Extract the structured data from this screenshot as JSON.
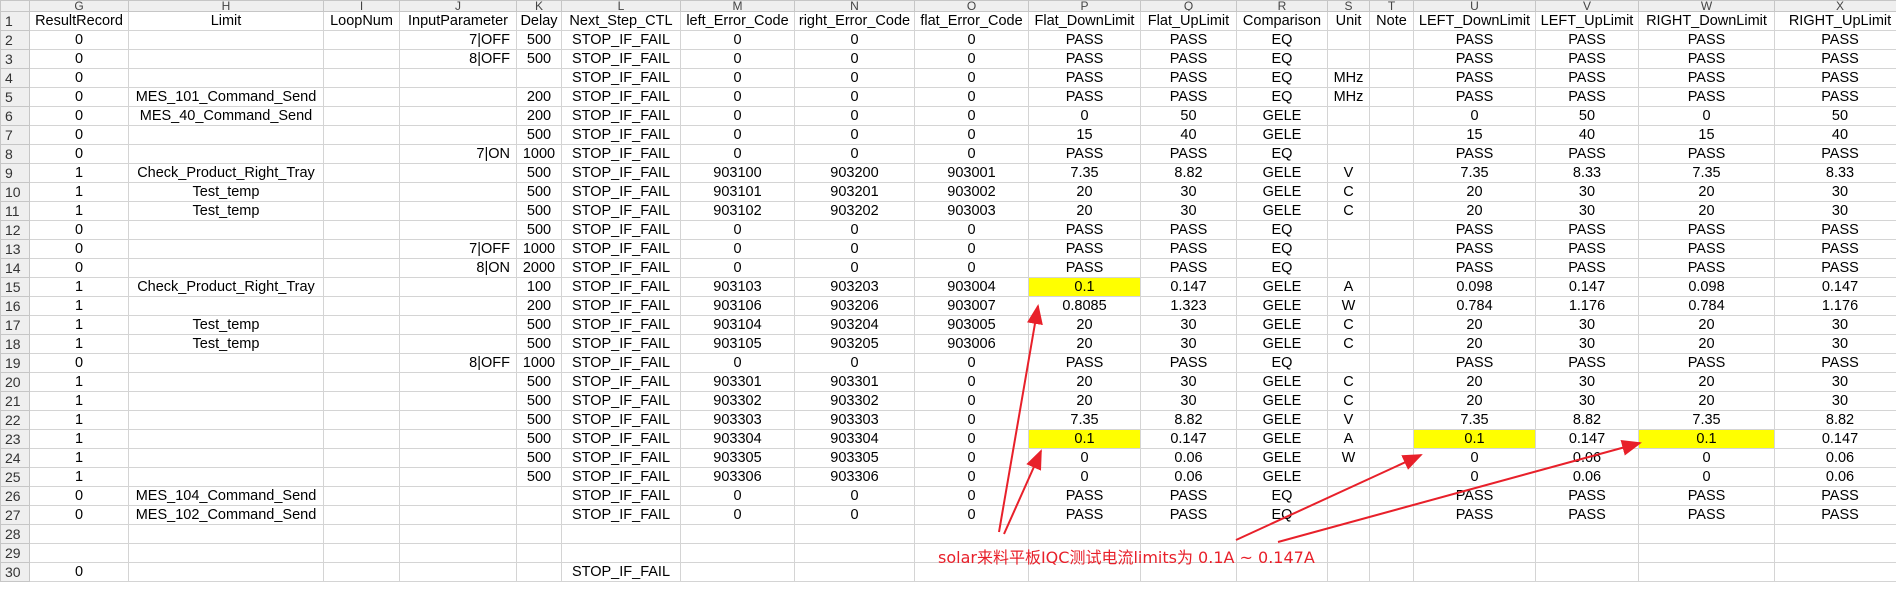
{
  "sheet": {
    "col_letters": [
      "",
      "G",
      "H",
      "I",
      "J",
      "K",
      "L",
      "M",
      "N",
      "O",
      "P",
      "Q",
      "R",
      "S",
      "T",
      "U",
      "V",
      "W",
      "X"
    ],
    "headers": [
      "ResultRecord",
      "Limit",
      "LoopNum",
      "InputParameter",
      "Delay",
      "Next_Step_CTL",
      "left_Error_Code",
      "right_Error_Code",
      "flat_Error_Code",
      "Flat_DownLimit",
      "Flat_UpLimit",
      "Comparison",
      "Unit",
      "Note",
      "LEFT_DownLimit",
      "LEFT_UpLimit",
      "RIGHT_DownLimit",
      "RIGHT_UpLimit"
    ],
    "rows": [
      {
        "n": "2",
        "c": [
          "0",
          "",
          "",
          "7|OFF",
          "500",
          "STOP_IF_FAIL",
          "0",
          "0",
          "0",
          "PASS",
          "PASS",
          "EQ",
          "",
          "",
          "PASS",
          "PASS",
          "PASS",
          "PASS"
        ]
      },
      {
        "n": "3",
        "c": [
          "0",
          "",
          "",
          "8|OFF",
          "500",
          "STOP_IF_FAIL",
          "0",
          "0",
          "0",
          "PASS",
          "PASS",
          "EQ",
          "",
          "",
          "PASS",
          "PASS",
          "PASS",
          "PASS"
        ]
      },
      {
        "n": "4",
        "c": [
          "0",
          "",
          "",
          "",
          "",
          "STOP_IF_FAIL",
          "0",
          "0",
          "0",
          "PASS",
          "PASS",
          "EQ",
          "MHz",
          "",
          "PASS",
          "PASS",
          "PASS",
          "PASS"
        ]
      },
      {
        "n": "5",
        "c": [
          "0",
          "MES_101_Command_Send",
          "",
          "",
          "200",
          "STOP_IF_FAIL",
          "0",
          "0",
          "0",
          "PASS",
          "PASS",
          "EQ",
          "MHz",
          "",
          "PASS",
          "PASS",
          "PASS",
          "PASS"
        ]
      },
      {
        "n": "6",
        "c": [
          "0",
          "MES_40_Command_Send",
          "",
          "",
          "200",
          "STOP_IF_FAIL",
          "0",
          "0",
          "0",
          "0",
          "50",
          "GELE",
          "",
          "",
          "0",
          "50",
          "0",
          "50"
        ]
      },
      {
        "n": "7",
        "c": [
          "0",
          "",
          "",
          "",
          "500",
          "STOP_IF_FAIL",
          "0",
          "0",
          "0",
          "15",
          "40",
          "GELE",
          "",
          "",
          "15",
          "40",
          "15",
          "40"
        ]
      },
      {
        "n": "8",
        "c": [
          "0",
          "",
          "",
          "7|ON",
          "1000",
          "STOP_IF_FAIL",
          "0",
          "0",
          "0",
          "PASS",
          "PASS",
          "EQ",
          "",
          "",
          "PASS",
          "PASS",
          "PASS",
          "PASS"
        ]
      },
      {
        "n": "9",
        "c": [
          "1",
          "Check_Product_Right_Tray",
          "",
          "",
          "500",
          "STOP_IF_FAIL",
          "903100",
          "903200",
          "903001",
          "7.35",
          "8.82",
          "GELE",
          "V",
          "",
          "7.35",
          "8.33",
          "7.35",
          "8.33"
        ]
      },
      {
        "n": "10",
        "c": [
          "1",
          "Test_temp",
          "",
          "",
          "500",
          "STOP_IF_FAIL",
          "903101",
          "903201",
          "903002",
          "20",
          "30",
          "GELE",
          "C",
          "",
          "20",
          "30",
          "20",
          "30"
        ]
      },
      {
        "n": "11",
        "c": [
          "1",
          "Test_temp",
          "",
          "",
          "500",
          "STOP_IF_FAIL",
          "903102",
          "903202",
          "903003",
          "20",
          "30",
          "GELE",
          "C",
          "",
          "20",
          "30",
          "20",
          "30"
        ]
      },
      {
        "n": "12",
        "c": [
          "0",
          "",
          "",
          "",
          "500",
          "STOP_IF_FAIL",
          "0",
          "0",
          "0",
          "PASS",
          "PASS",
          "EQ",
          "",
          "",
          "PASS",
          "PASS",
          "PASS",
          "PASS"
        ]
      },
      {
        "n": "13",
        "c": [
          "0",
          "",
          "",
          "7|OFF",
          "1000",
          "STOP_IF_FAIL",
          "0",
          "0",
          "0",
          "PASS",
          "PASS",
          "EQ",
          "",
          "",
          "PASS",
          "PASS",
          "PASS",
          "PASS"
        ]
      },
      {
        "n": "14",
        "c": [
          "0",
          "",
          "",
          "8|ON",
          "2000",
          "STOP_IF_FAIL",
          "0",
          "0",
          "0",
          "PASS",
          "PASS",
          "EQ",
          "",
          "",
          "PASS",
          "PASS",
          "PASS",
          "PASS"
        ]
      },
      {
        "n": "15",
        "c": [
          "1",
          "Check_Product_Right_Tray",
          "",
          "",
          "100",
          "STOP_IF_FAIL",
          "903103",
          "903203",
          "903004",
          "0.1",
          "0.147",
          "GELE",
          "A",
          "",
          "0.098",
          "0.147",
          "0.098",
          "0.147"
        ],
        "hl": [
          9
        ]
      },
      {
        "n": "16",
        "c": [
          "1",
          "",
          "",
          "",
          "200",
          "STOP_IF_FAIL",
          "903106",
          "903206",
          "903007",
          "0.8085",
          "1.323",
          "GELE",
          "W",
          "",
          "0.784",
          "1.176",
          "0.784",
          "1.176"
        ]
      },
      {
        "n": "17",
        "c": [
          "1",
          "Test_temp",
          "",
          "",
          "500",
          "STOP_IF_FAIL",
          "903104",
          "903204",
          "903005",
          "20",
          "30",
          "GELE",
          "C",
          "",
          "20",
          "30",
          "20",
          "30"
        ]
      },
      {
        "n": "18",
        "c": [
          "1",
          "Test_temp",
          "",
          "",
          "500",
          "STOP_IF_FAIL",
          "903105",
          "903205",
          "903006",
          "20",
          "30",
          "GELE",
          "C",
          "",
          "20",
          "30",
          "20",
          "30"
        ]
      },
      {
        "n": "19",
        "c": [
          "0",
          "",
          "",
          "8|OFF",
          "1000",
          "STOP_IF_FAIL",
          "0",
          "0",
          "0",
          "PASS",
          "PASS",
          "EQ",
          "",
          "",
          "PASS",
          "PASS",
          "PASS",
          "PASS"
        ]
      },
      {
        "n": "20",
        "c": [
          "1",
          "",
          "",
          "",
          "500",
          "STOP_IF_FAIL",
          "903301",
          "903301",
          "0",
          "20",
          "30",
          "GELE",
          "C",
          "",
          "20",
          "30",
          "20",
          "30"
        ]
      },
      {
        "n": "21",
        "c": [
          "1",
          "",
          "",
          "",
          "500",
          "STOP_IF_FAIL",
          "903302",
          "903302",
          "0",
          "20",
          "30",
          "GELE",
          "C",
          "",
          "20",
          "30",
          "20",
          "30"
        ]
      },
      {
        "n": "22",
        "c": [
          "1",
          "",
          "",
          "",
          "500",
          "STOP_IF_FAIL",
          "903303",
          "903303",
          "0",
          "7.35",
          "8.82",
          "GELE",
          "V",
          "",
          "7.35",
          "8.82",
          "7.35",
          "8.82"
        ]
      },
      {
        "n": "23",
        "c": [
          "1",
          "",
          "",
          "",
          "500",
          "STOP_IF_FAIL",
          "903304",
          "903304",
          "0",
          "0.1",
          "0.147",
          "GELE",
          "A",
          "",
          "0.1",
          "0.147",
          "0.1",
          "0.147"
        ],
        "hl": [
          9,
          14,
          16
        ]
      },
      {
        "n": "24",
        "c": [
          "1",
          "",
          "",
          "",
          "500",
          "STOP_IF_FAIL",
          "903305",
          "903305",
          "0",
          "0",
          "0.06",
          "GELE",
          "W",
          "",
          "0",
          "0.06",
          "0",
          "0.06"
        ]
      },
      {
        "n": "25",
        "c": [
          "1",
          "",
          "",
          "",
          "500",
          "STOP_IF_FAIL",
          "903306",
          "903306",
          "0",
          "0",
          "0.06",
          "GELE",
          "",
          "",
          "0",
          "0.06",
          "0",
          "0.06"
        ]
      },
      {
        "n": "26",
        "c": [
          "0",
          "MES_104_Command_Send",
          "",
          "",
          "",
          "STOP_IF_FAIL",
          "0",
          "0",
          "0",
          "PASS",
          "PASS",
          "EQ",
          "",
          "",
          "PASS",
          "PASS",
          "PASS",
          "PASS"
        ]
      },
      {
        "n": "27",
        "c": [
          "0",
          "MES_102_Command_Send",
          "",
          "",
          "",
          "STOP_IF_FAIL",
          "0",
          "0",
          "0",
          "PASS",
          "PASS",
          "EQ",
          "",
          "",
          "PASS",
          "PASS",
          "PASS",
          "PASS"
        ]
      },
      {
        "n": "28",
        "c": [
          "",
          "",
          "",
          "",
          "",
          "",
          "",
          "",
          "",
          "",
          "",
          "",
          "",
          "",
          "",
          "",
          "",
          ""
        ]
      },
      {
        "n": "29",
        "c": [
          "",
          "",
          "",
          "",
          "",
          "",
          "",
          "",
          "",
          "",
          "",
          "",
          "",
          "",
          "",
          "",
          "",
          ""
        ]
      },
      {
        "n": "30",
        "c": [
          "0",
          "",
          "",
          "",
          "",
          "STOP_IF_FAIL",
          "",
          "",
          "",
          "",
          "",
          "",
          "",
          "",
          "",
          "",
          "",
          ""
        ]
      }
    ]
  },
  "annotation": {
    "text": "solar来料平板IQC测试电流limits为 0.1A ~ 0.147A",
    "color": "#e8202a"
  }
}
